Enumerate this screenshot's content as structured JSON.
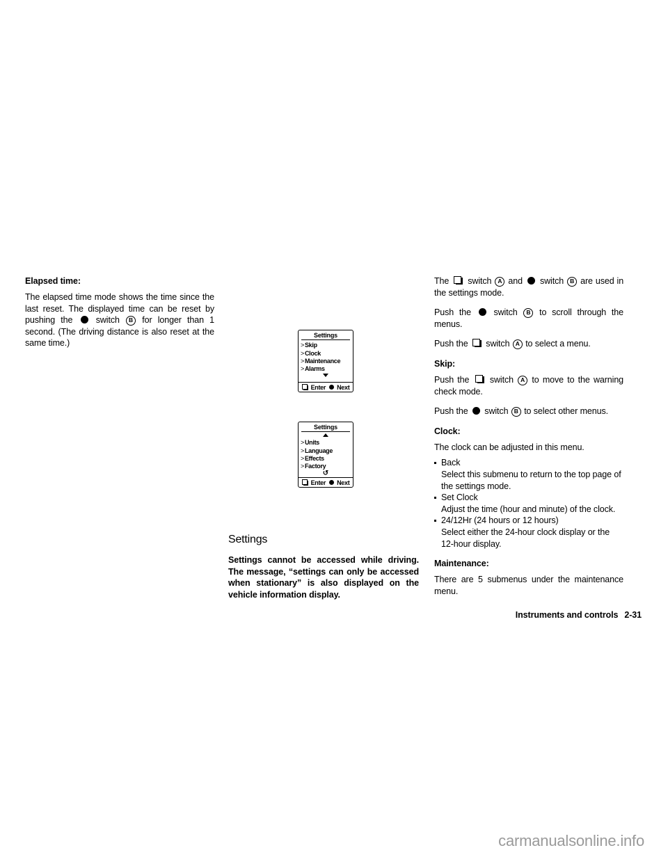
{
  "document": {
    "footer_section": "Instruments and controls",
    "page_number": "2-31",
    "watermark": "carmanualsonline.info"
  },
  "left_column": {
    "heading": "Elapsed time:",
    "paragraph_part1": "The elapsed time mode shows the time since the last reset. The displayed time can be reset by pushing the",
    "paragraph_switch_word": "switch",
    "paragraph_switch_letter": "B",
    "paragraph_part2": "for longer than 1 second. (The driving distance is also reset at the same time.)"
  },
  "middle_column": {
    "section_title": "Settings",
    "warning_text": "Settings cannot be accessed while driving. The message, “settings can only be accessed when stationary” is also displayed on the vehicle information display."
  },
  "lcd_top": {
    "title": "Settings",
    "items": [
      {
        "chevron": ">",
        "label": "Skip"
      },
      {
        "chevron": ">",
        "label": "Clock"
      },
      {
        "chevron": ">",
        "label": "Maintenance"
      },
      {
        "chevron": ">",
        "label": "Alarms"
      }
    ],
    "scroll_indicator": "down-arrow",
    "footer_enter": "Enter",
    "footer_next": "Next"
  },
  "lcd_bottom": {
    "title": "Settings",
    "scroll_indicator_top": "up-arrow",
    "items": [
      {
        "chevron": ">",
        "label": "Units"
      },
      {
        "chevron": ">",
        "label": "Language"
      },
      {
        "chevron": ">",
        "label": "Effects"
      },
      {
        "chevron": ">",
        "label": "Factory"
      }
    ],
    "return_indicator": "↺",
    "footer_enter": "Enter",
    "footer_next": "Next"
  },
  "right_column": {
    "intro_part1": "The",
    "intro_switch_word1": "switch",
    "intro_letter_a": "A",
    "intro_and": "and",
    "intro_switch_word2": "switch",
    "intro_letter_b": "B",
    "intro_part2": "are used in the settings mode.",
    "scroll_part1": "Push the",
    "scroll_switch_word": "switch",
    "scroll_letter": "B",
    "scroll_part2": "to scroll through the menus.",
    "select_part1": "Push the",
    "select_switch_word": "switch",
    "select_letter": "A",
    "select_part2": "to select a menu.",
    "skip_heading": "Skip:",
    "skip_line1_part1": "Push the",
    "skip_line1_switch_word": "switch",
    "skip_line1_letter": "A",
    "skip_line1_part2": "to move to the warning check mode.",
    "skip_line2_part1": "Push the",
    "skip_line2_switch_word": "switch",
    "skip_line2_letter": "B",
    "skip_line2_part2": "to select other menus.",
    "clock_heading": "Clock:",
    "clock_intro": "The clock can be adjusted in this menu.",
    "clock_items": [
      {
        "label": "Back",
        "description": "Select this submenu to return to the top page of the settings mode."
      },
      {
        "label": "Set Clock",
        "description": "Adjust the time (hour and minute) of the clock."
      },
      {
        "label": "24/12Hr (24 hours or 12 hours)",
        "description": "Select either the 24-hour clock display or the 12-hour display."
      }
    ],
    "maintenance_heading": "Maintenance:",
    "maintenance_text": "There are 5 submenus under the maintenance menu."
  }
}
